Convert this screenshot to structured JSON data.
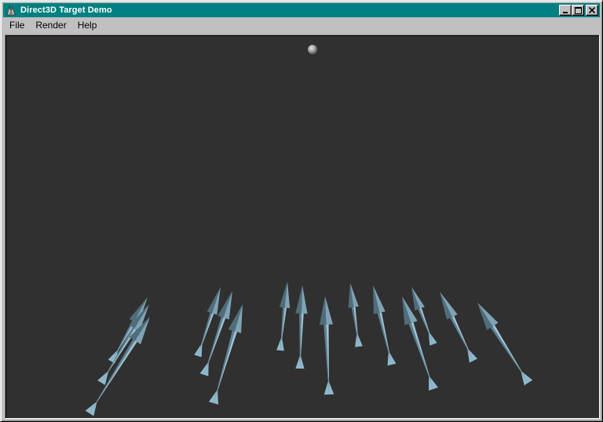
{
  "window": {
    "title": "Direct3D Target Demo",
    "app_icon": "direct3d-app-icon",
    "caption_buttons": [
      "minimize",
      "maximize",
      "close"
    ]
  },
  "menu": {
    "items": [
      {
        "label": "File"
      },
      {
        "label": "Render"
      },
      {
        "label": "Help"
      }
    ]
  },
  "scene": {
    "background_color": "#303030",
    "target_sphere": "target-sphere",
    "arrow_count": 15,
    "arrow_color": "#7fa3b5"
  }
}
